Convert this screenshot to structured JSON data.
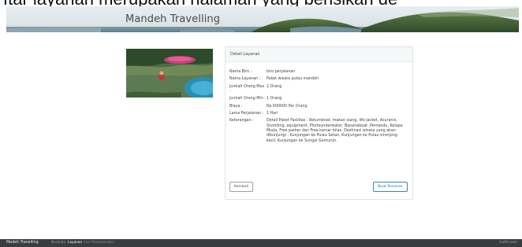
{
  "caption": "ftar layanan merupakan halaman yang berisikan de",
  "header": {
    "brand": "Mandeh Travelling"
  },
  "card": {
    "title": "Detail Layanan",
    "rows": [
      {
        "label": "Nama Biro :",
        "value": "biro perjalanan"
      },
      {
        "label": "Nama Layanan :",
        "value": "Paket wisata pulau mandeh"
      },
      {
        "label": "Jumlah Orang Max :",
        "value": "2 Orang"
      },
      {
        "label": "Jumlah Orang Min :",
        "value": "1 Orang"
      },
      {
        "label": "Biaya :",
        "value": "Rp 600000 Per Orang"
      },
      {
        "label": "Lama Perjalanan :",
        "value": "1 Hari"
      },
      {
        "label": "Keterangan :",
        "value": "Detail Paket Fasilitas : Returnboat, makan siang, life jacket, Asuransi, Snorkling, equipment, Photounderwater, Bananaboat ,Pemandu, Kelapa Muda, Free parker dan Free kamar bilas. Destinasi wisata yang akan dikunjungi : Kunjungan ke Pulau Setan, Kunjungan ke Pulau sironjong kecil, Kunjungan ke Sungai Gemuruh."
      }
    ],
    "back_label": "Kembali",
    "order_label": "Buat Pesanan"
  },
  "footer": {
    "brand": "Madeh Travelling",
    "nav": [
      "Beranda",
      "Layanan",
      "Cari Rekomendasi"
    ],
    "right": "Fadhli.wan"
  },
  "colors": {
    "primary": "#3b82c4",
    "footer_bg": "#3a3c3f"
  }
}
